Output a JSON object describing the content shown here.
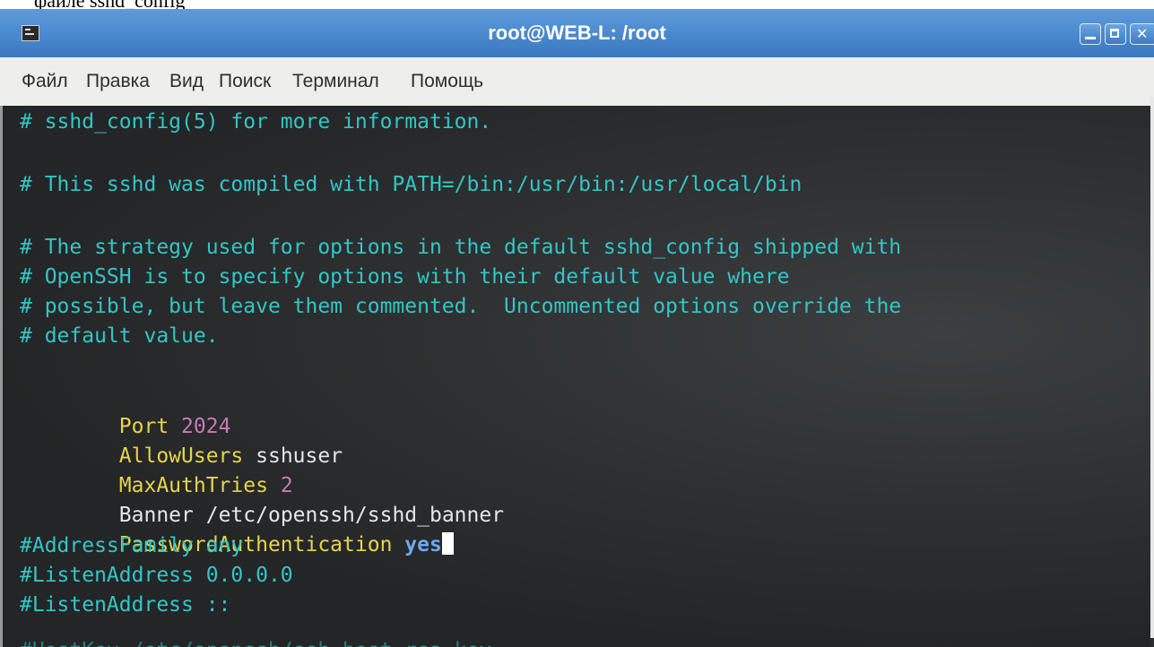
{
  "document": {
    "caption_fragment": "файле sshd_config"
  },
  "window": {
    "title": "root@WEB-L: /root"
  },
  "menu": [
    "Файл",
    "Правка",
    "Вид",
    "Поиск",
    "Терминал",
    "Помощь"
  ],
  "terminal": {
    "comment_1": "# sshd_config(5) for more information.",
    "comment_2": "# This sshd was compiled with PATH=/bin:/usr/bin:/usr/local/bin",
    "comment_3": "# The strategy used for options in the default sshd_config shipped with",
    "comment_4": "# OpenSSH is to specify options with their default value where",
    "comment_5": "# possible, but leave them commented.  Uncommented options override the",
    "comment_6": "# default value.",
    "port_key": "Port",
    "port_value": "2024",
    "allowusers_key": "AllowUsers",
    "allowusers_value": "sshuser",
    "maxauth_key": "MaxAuthTries",
    "maxauth_value": "2",
    "banner_key": "Banner",
    "banner_value": "/etc/openssh/sshd_banner",
    "password_key": "PasswordAuthentication",
    "password_value": "yes",
    "addressfamily": "#AddressFamily any",
    "listen_1": "#ListenAddress 0.0.0.0",
    "listen_2": "#ListenAddress ::",
    "cutoff_line": "#HostKey /etc/openssh/ssh_host_rsa_key"
  },
  "colors": {
    "comment": "#33c6c6",
    "keyword": "#e6d54a",
    "number": "#c77ab8",
    "value_bold": "#6fa6f0",
    "background": "#2b2d2e",
    "titlebar": "#4a89d0"
  }
}
